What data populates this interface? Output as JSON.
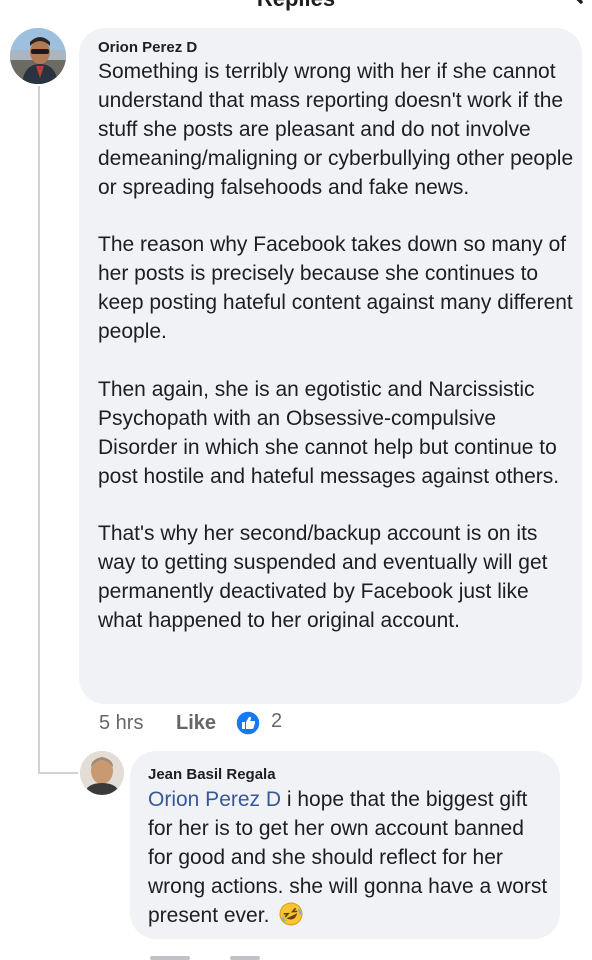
{
  "header": {
    "title": "Replies",
    "search_icon": "search-icon"
  },
  "comment": {
    "author": "Orion Perez D",
    "paragraphs": [
      "Something is terribly wrong with her if she cannot understand that mass reporting doesn't work if the stuff she posts are pleasant and do not involve demeaning/maligning or cyberbullying other people or spreading falsehoods and fake news.",
      "The reason why Facebook takes down so many of her posts is precisely because she continues to keep posting hateful content against many different people.",
      "Then again, she is an egotistic and Narcissistic Psychopath with an Obsessive-compulsive Disorder in which she cannot help but continue to post hostile and hateful messages against others.",
      "That's why her second/backup account is on its way to getting suspended and eventually will get permanently deactivated by Facebook just like what happened to her original account."
    ],
    "time": "5 hrs",
    "like_label": "Like",
    "reaction_count": "2",
    "reaction_icon": "thumbs-up-icon",
    "reaction_color": "#1877f2"
  },
  "reply": {
    "author": "Jean Basil Regala",
    "mention": "Orion Perez D",
    "text": " i hope that the biggest gift for her is to get her own account banned for good and she should reflect for her wrong actions. she will gonna have a worst present ever.",
    "emoji": "rolling-laughing-emoji"
  },
  "colors": {
    "bubble": "#f0f2f5",
    "mention": "#385898",
    "meta": "#65676b"
  }
}
